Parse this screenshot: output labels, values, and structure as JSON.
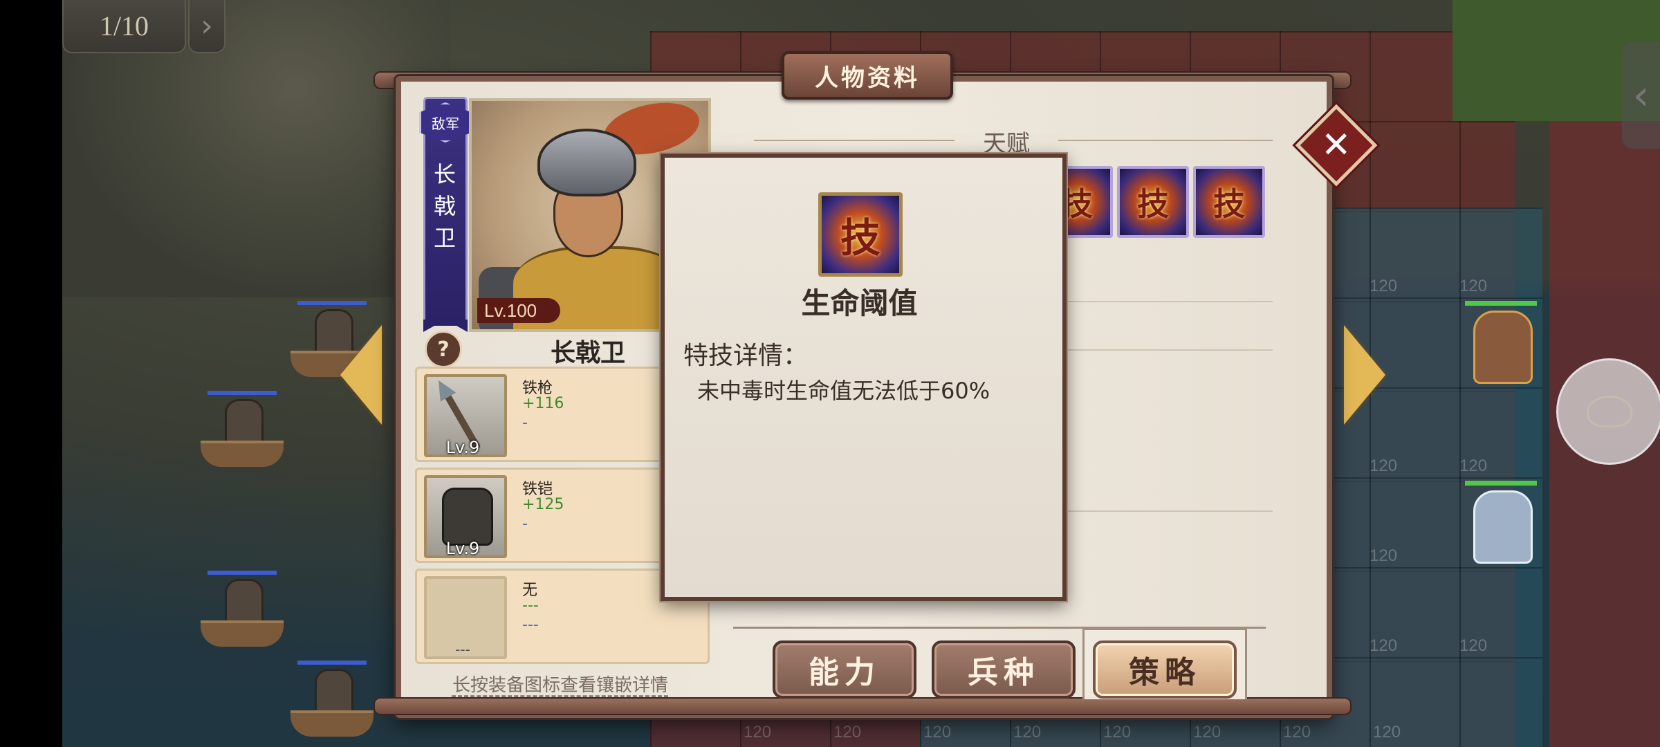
{
  "hud": {
    "counter": "1/10",
    "next_icon": "chevron-right-icon",
    "back_icon": "chevron-left-icon"
  },
  "map": {
    "tile_cost": "120"
  },
  "panel": {
    "title": "人物资料",
    "close_icon": "close-icon",
    "prev_icon": "arrow-left-icon",
    "next_icon": "arrow-right-icon"
  },
  "character": {
    "faction": "敌军",
    "name": "长戟卫",
    "level": "Lv.100",
    "help": "?"
  },
  "equipment": [
    {
      "name": "铁枪",
      "bonus": "+116",
      "sub": "-",
      "level": "Lv.9",
      "icon": "spear-icon"
    },
    {
      "name": "铁铠",
      "bonus": "+125",
      "sub": "-",
      "level": "Lv.9",
      "icon": "armor-icon"
    },
    {
      "name": "无",
      "bonus": "---",
      "sub": "---",
      "level": "---",
      "icon": "empty-slot-icon"
    }
  ],
  "hint": "长按装备图标查看镶嵌详情",
  "talent": {
    "title": "天赋",
    "skills": [
      {
        "glyph": "技",
        "icon": "skill-icon"
      },
      {
        "glyph": "技",
        "icon": "skill-icon"
      },
      {
        "glyph": "技",
        "icon": "skill-icon"
      }
    ]
  },
  "popup": {
    "icon_glyph": "技",
    "title": "生命阈值",
    "label": "特技详情：",
    "description": "未中毒时生命值无法低于60%"
  },
  "tabs": [
    {
      "label": "能力",
      "active": false
    },
    {
      "label": "兵种",
      "active": false
    },
    {
      "label": "策略",
      "active": true
    }
  ],
  "colors": {
    "panel_border": "#7b5a4e",
    "bonus_green": "#3f8a2c",
    "banner_purple": "#2a2266",
    "close_red": "#7c1f1f"
  }
}
